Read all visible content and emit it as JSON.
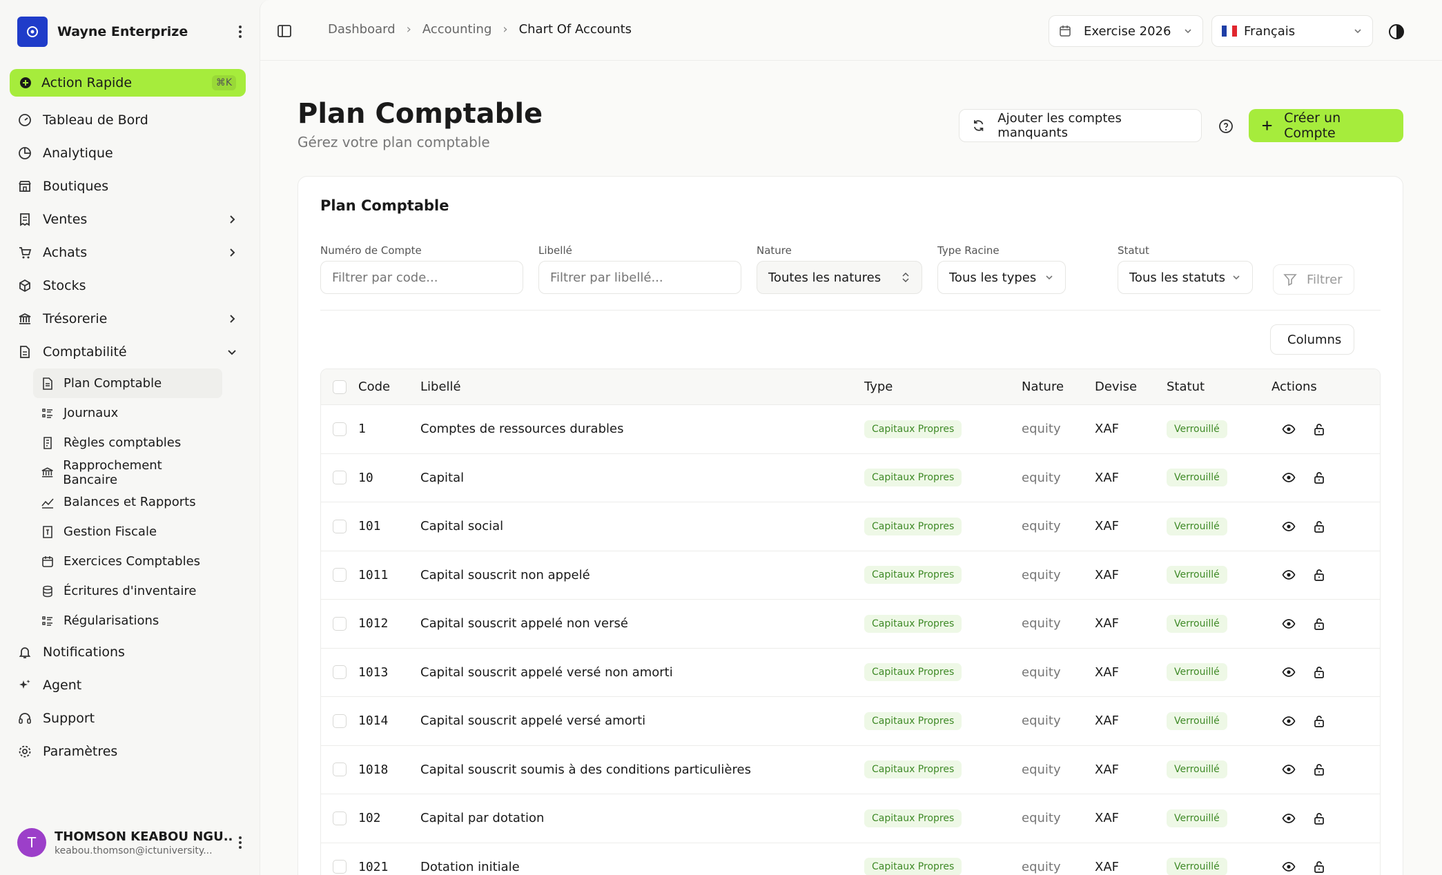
{
  "sidebar": {
    "org_name": "Wayne Enterprize",
    "quick_action": {
      "label": "Action Rapide",
      "shortcut": "⌘K"
    },
    "items": [
      {
        "label": "Tableau de Bord",
        "icon": "dashboard-icon"
      },
      {
        "label": "Analytique",
        "icon": "pie-chart-icon"
      },
      {
        "label": "Boutiques",
        "icon": "store-icon"
      },
      {
        "label": "Ventes",
        "icon": "receipt-icon",
        "chevron": "right"
      },
      {
        "label": "Achats",
        "icon": "cart-icon",
        "chevron": "right"
      },
      {
        "label": "Stocks",
        "icon": "box-icon"
      },
      {
        "label": "Trésorerie",
        "icon": "bank-icon",
        "chevron": "right"
      },
      {
        "label": "Comptabilité",
        "icon": "document-icon",
        "chevron": "down"
      }
    ],
    "sub_items": [
      {
        "label": "Plan Comptable",
        "icon": "file-text-icon",
        "active": true
      },
      {
        "label": "Journaux",
        "icon": "list-icon"
      },
      {
        "label": "Règles comptables",
        "icon": "rules-icon"
      },
      {
        "label": "Rapprochement Bancaire",
        "icon": "bank-icon"
      },
      {
        "label": "Balances et Rapports",
        "icon": "trend-icon"
      },
      {
        "label": "Gestion Fiscale",
        "icon": "tax-icon"
      },
      {
        "label": "Exercices Comptables",
        "icon": "calendar-icon"
      },
      {
        "label": "Écritures d'inventaire",
        "icon": "database-icon"
      },
      {
        "label": "Régularisations",
        "icon": "list-icon"
      }
    ],
    "bottom_items": [
      {
        "label": "Notifications",
        "icon": "bell-icon"
      },
      {
        "label": "Agent",
        "icon": "sparkles-icon"
      },
      {
        "label": "Support",
        "icon": "headset-icon"
      },
      {
        "label": "Paramètres",
        "icon": "gear-icon"
      }
    ],
    "user": {
      "initial": "T",
      "name": "THOMSON KEABOU NGU...",
      "email": "keabou.thomson@ictuniversity..."
    }
  },
  "header": {
    "breadcrumbs": [
      "Dashboard",
      "Accounting",
      "Chart Of Accounts"
    ],
    "exercise": "Exercise 2026",
    "language": "Français"
  },
  "page": {
    "title": "Plan Comptable",
    "subtitle": "Gérez votre plan comptable",
    "btn_missing": "Ajouter les comptes manquants",
    "btn_create": "Créer un Compte"
  },
  "card": {
    "title": "Plan Comptable",
    "filters": {
      "code": {
        "label": "Numéro de Compte",
        "placeholder": "Filtrer par code..."
      },
      "libelle": {
        "label": "Libellé",
        "placeholder": "Filtrer par libellé..."
      },
      "nature": {
        "label": "Nature",
        "value": "Toutes les natures"
      },
      "type": {
        "label": "Type Racine",
        "value": "Tous les types"
      },
      "statut": {
        "label": "Statut",
        "value": "Tous les statuts"
      },
      "filter_btn": "Filtrer"
    },
    "columns_btn": "Columns",
    "table": {
      "headers": [
        "Code",
        "Libellé",
        "Type",
        "Nature",
        "Devise",
        "Statut",
        "Actions"
      ],
      "rows": [
        {
          "code": "1",
          "libelle": "Comptes de ressources durables",
          "type": "Capitaux Propres",
          "nature": "equity",
          "devise": "XAF",
          "statut": "Verrouillé"
        },
        {
          "code": "10",
          "libelle": "Capital",
          "type": "Capitaux Propres",
          "nature": "equity",
          "devise": "XAF",
          "statut": "Verrouillé"
        },
        {
          "code": "101",
          "libelle": "Capital social",
          "type": "Capitaux Propres",
          "nature": "equity",
          "devise": "XAF",
          "statut": "Verrouillé"
        },
        {
          "code": "1011",
          "libelle": "Capital souscrit non appelé",
          "type": "Capitaux Propres",
          "nature": "equity",
          "devise": "XAF",
          "statut": "Verrouillé"
        },
        {
          "code": "1012",
          "libelle": "Capital souscrit appelé non versé",
          "type": "Capitaux Propres",
          "nature": "equity",
          "devise": "XAF",
          "statut": "Verrouillé"
        },
        {
          "code": "1013",
          "libelle": "Capital souscrit appelé versé non amorti",
          "type": "Capitaux Propres",
          "nature": "equity",
          "devise": "XAF",
          "statut": "Verrouillé"
        },
        {
          "code": "1014",
          "libelle": "Capital souscrit appelé versé amorti",
          "type": "Capitaux Propres",
          "nature": "equity",
          "devise": "XAF",
          "statut": "Verrouillé"
        },
        {
          "code": "1018",
          "libelle": "Capital souscrit soumis à des conditions particulières",
          "type": "Capitaux Propres",
          "nature": "equity",
          "devise": "XAF",
          "statut": "Verrouillé"
        },
        {
          "code": "102",
          "libelle": "Capital par dotation",
          "type": "Capitaux Propres",
          "nature": "equity",
          "devise": "XAF",
          "statut": "Verrouillé"
        },
        {
          "code": "1021",
          "libelle": "Dotation initiale",
          "type": "Capitaux Propres",
          "nature": "equity",
          "devise": "XAF",
          "statut": "Verrouillé"
        }
      ]
    }
  },
  "colors": {
    "accent": "#a6ec3c",
    "badge_bg": "#eef8e6",
    "badge_text": "#3f8a27",
    "brand": "#1f3cc9",
    "avatar": "#9c3fc9"
  }
}
